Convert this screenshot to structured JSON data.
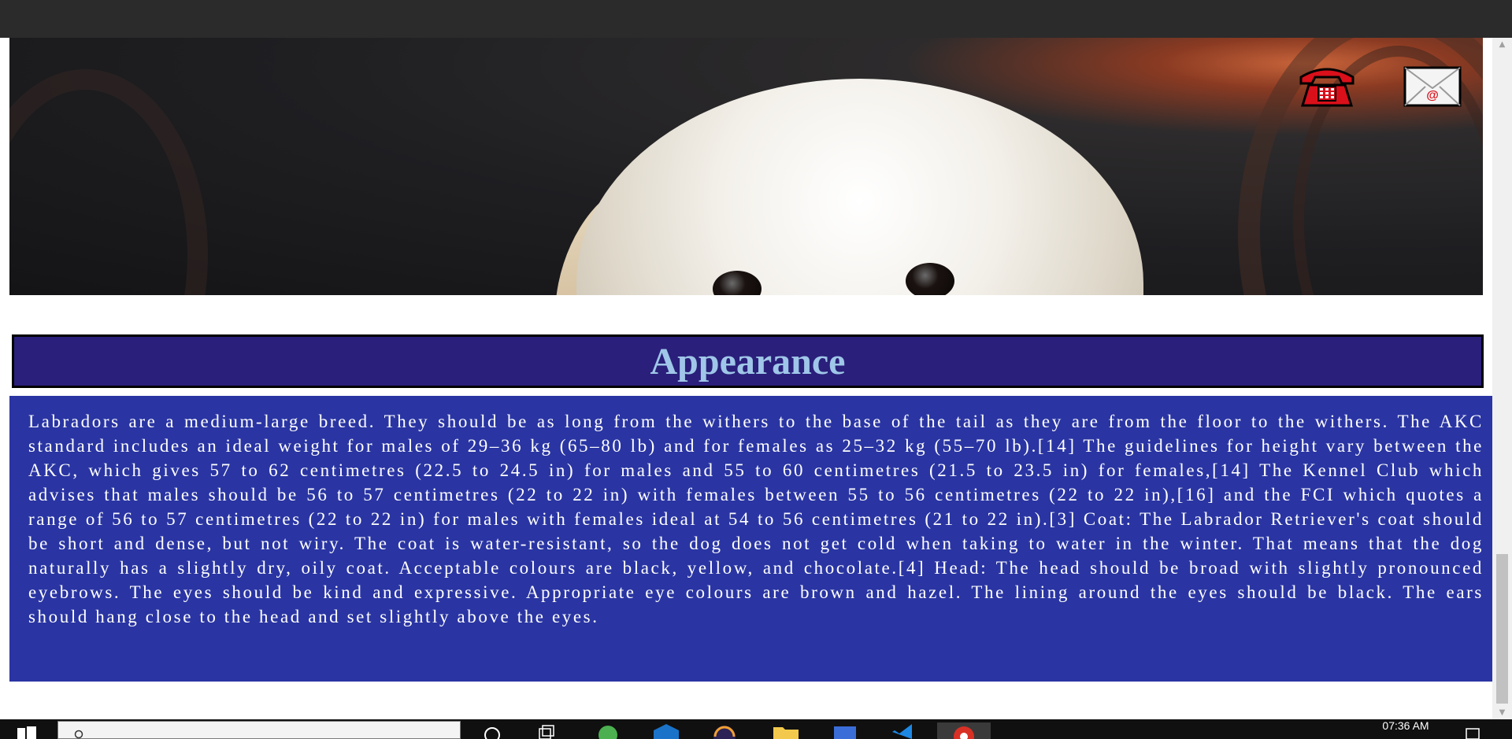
{
  "hero": {
    "image_subject": "labrador-puppy-photo",
    "icons": [
      "telephone-icon",
      "envelope-icon"
    ]
  },
  "appearance": {
    "heading": "Appearance",
    "body": "Labradors are a medium-large breed. They should be as long from the withers to the base of the tail as they are from the floor to the withers. The AKC standard includes an ideal weight for males of 29–36 kg (65–80 lb) and for females as 25–32 kg (55–70 lb).[14] The guidelines for height vary between the AKC, which gives 57 to 62 centimetres (22.5 to 24.5 in) for males and 55 to 60 centimetres (21.5 to 23.5 in) for females,[14] The Kennel Club which advises that males should be 56 to 57 centimetres (22 to 22 in) with females between 55 to 56 centimetres (22 to 22 in),[16] and the FCI which quotes a range of 56 to 57 centimetres (22 to 22 in) for males with females ideal at 54 to 56 centimetres (21 to 22 in).[3] Coat: The Labrador Retriever's coat should be short and dense, but not wiry. The coat is water-resistant, so the dog does not get cold when taking to water in the winter. That means that the dog naturally has a slightly dry, oily coat. Acceptable colours are black, yellow, and chocolate.[4] Head: The head should be broad with slightly pronounced eyebrows. The eyes should be kind and expressive. Appropriate eye colours are brown and hazel. The lining around the eyes should be black. The ears should hang close to the head and set slightly above the eyes."
  },
  "taskbar": {
    "clock": "07:36 AM",
    "apps": [
      "cortana-icon",
      "task-view-icon",
      "green-app-icon",
      "mail-app-icon",
      "eclipse-icon",
      "file-explorer-icon",
      "word-app-icon",
      "vscode-icon",
      "chrome-icon"
    ]
  },
  "colors": {
    "heading_bg": "#2a1f7a",
    "heading_text": "#9fc6e8",
    "body_bg": "#2a35a3",
    "body_text": "#ffffff",
    "top_bar": "#2b2b2b",
    "taskbar": "#101010"
  }
}
